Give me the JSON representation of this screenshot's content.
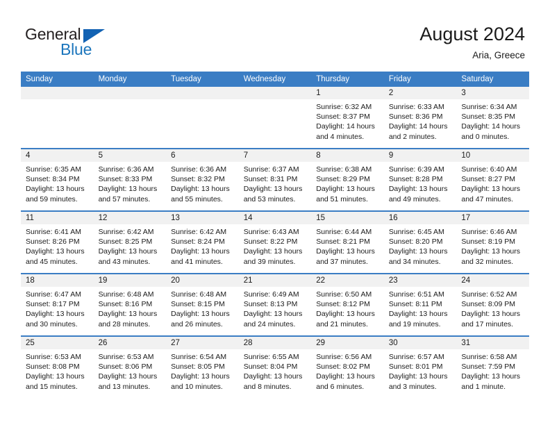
{
  "header": {
    "logo": {
      "word_one": "General",
      "word_two": "Blue",
      "triangle_color": "#1262b3",
      "blue_color": "#1b75bc"
    },
    "month_title": "August 2024",
    "location": "Aria, Greece"
  },
  "calendar": {
    "accent_color": "#3a7dc4",
    "weekday_headers": [
      "Sunday",
      "Monday",
      "Tuesday",
      "Wednesday",
      "Thursday",
      "Friday",
      "Saturday"
    ],
    "weeks": [
      [
        {
          "day": "",
          "sunrise": "",
          "sunset": "",
          "daylight": ""
        },
        {
          "day": "",
          "sunrise": "",
          "sunset": "",
          "daylight": ""
        },
        {
          "day": "",
          "sunrise": "",
          "sunset": "",
          "daylight": ""
        },
        {
          "day": "",
          "sunrise": "",
          "sunset": "",
          "daylight": ""
        },
        {
          "day": "1",
          "sunrise": "Sunrise: 6:32 AM",
          "sunset": "Sunset: 8:37 PM",
          "daylight": "Daylight: 14 hours and 4 minutes."
        },
        {
          "day": "2",
          "sunrise": "Sunrise: 6:33 AM",
          "sunset": "Sunset: 8:36 PM",
          "daylight": "Daylight: 14 hours and 2 minutes."
        },
        {
          "day": "3",
          "sunrise": "Sunrise: 6:34 AM",
          "sunset": "Sunset: 8:35 PM",
          "daylight": "Daylight: 14 hours and 0 minutes."
        }
      ],
      [
        {
          "day": "4",
          "sunrise": "Sunrise: 6:35 AM",
          "sunset": "Sunset: 8:34 PM",
          "daylight": "Daylight: 13 hours and 59 minutes."
        },
        {
          "day": "5",
          "sunrise": "Sunrise: 6:36 AM",
          "sunset": "Sunset: 8:33 PM",
          "daylight": "Daylight: 13 hours and 57 minutes."
        },
        {
          "day": "6",
          "sunrise": "Sunrise: 6:36 AM",
          "sunset": "Sunset: 8:32 PM",
          "daylight": "Daylight: 13 hours and 55 minutes."
        },
        {
          "day": "7",
          "sunrise": "Sunrise: 6:37 AM",
          "sunset": "Sunset: 8:31 PM",
          "daylight": "Daylight: 13 hours and 53 minutes."
        },
        {
          "day": "8",
          "sunrise": "Sunrise: 6:38 AM",
          "sunset": "Sunset: 8:29 PM",
          "daylight": "Daylight: 13 hours and 51 minutes."
        },
        {
          "day": "9",
          "sunrise": "Sunrise: 6:39 AM",
          "sunset": "Sunset: 8:28 PM",
          "daylight": "Daylight: 13 hours and 49 minutes."
        },
        {
          "day": "10",
          "sunrise": "Sunrise: 6:40 AM",
          "sunset": "Sunset: 8:27 PM",
          "daylight": "Daylight: 13 hours and 47 minutes."
        }
      ],
      [
        {
          "day": "11",
          "sunrise": "Sunrise: 6:41 AM",
          "sunset": "Sunset: 8:26 PM",
          "daylight": "Daylight: 13 hours and 45 minutes."
        },
        {
          "day": "12",
          "sunrise": "Sunrise: 6:42 AM",
          "sunset": "Sunset: 8:25 PM",
          "daylight": "Daylight: 13 hours and 43 minutes."
        },
        {
          "day": "13",
          "sunrise": "Sunrise: 6:42 AM",
          "sunset": "Sunset: 8:24 PM",
          "daylight": "Daylight: 13 hours and 41 minutes."
        },
        {
          "day": "14",
          "sunrise": "Sunrise: 6:43 AM",
          "sunset": "Sunset: 8:22 PM",
          "daylight": "Daylight: 13 hours and 39 minutes."
        },
        {
          "day": "15",
          "sunrise": "Sunrise: 6:44 AM",
          "sunset": "Sunset: 8:21 PM",
          "daylight": "Daylight: 13 hours and 37 minutes."
        },
        {
          "day": "16",
          "sunrise": "Sunrise: 6:45 AM",
          "sunset": "Sunset: 8:20 PM",
          "daylight": "Daylight: 13 hours and 34 minutes."
        },
        {
          "day": "17",
          "sunrise": "Sunrise: 6:46 AM",
          "sunset": "Sunset: 8:19 PM",
          "daylight": "Daylight: 13 hours and 32 minutes."
        }
      ],
      [
        {
          "day": "18",
          "sunrise": "Sunrise: 6:47 AM",
          "sunset": "Sunset: 8:17 PM",
          "daylight": "Daylight: 13 hours and 30 minutes."
        },
        {
          "day": "19",
          "sunrise": "Sunrise: 6:48 AM",
          "sunset": "Sunset: 8:16 PM",
          "daylight": "Daylight: 13 hours and 28 minutes."
        },
        {
          "day": "20",
          "sunrise": "Sunrise: 6:48 AM",
          "sunset": "Sunset: 8:15 PM",
          "daylight": "Daylight: 13 hours and 26 minutes."
        },
        {
          "day": "21",
          "sunrise": "Sunrise: 6:49 AM",
          "sunset": "Sunset: 8:13 PM",
          "daylight": "Daylight: 13 hours and 24 minutes."
        },
        {
          "day": "22",
          "sunrise": "Sunrise: 6:50 AM",
          "sunset": "Sunset: 8:12 PM",
          "daylight": "Daylight: 13 hours and 21 minutes."
        },
        {
          "day": "23",
          "sunrise": "Sunrise: 6:51 AM",
          "sunset": "Sunset: 8:11 PM",
          "daylight": "Daylight: 13 hours and 19 minutes."
        },
        {
          "day": "24",
          "sunrise": "Sunrise: 6:52 AM",
          "sunset": "Sunset: 8:09 PM",
          "daylight": "Daylight: 13 hours and 17 minutes."
        }
      ],
      [
        {
          "day": "25",
          "sunrise": "Sunrise: 6:53 AM",
          "sunset": "Sunset: 8:08 PM",
          "daylight": "Daylight: 13 hours and 15 minutes."
        },
        {
          "day": "26",
          "sunrise": "Sunrise: 6:53 AM",
          "sunset": "Sunset: 8:06 PM",
          "daylight": "Daylight: 13 hours and 13 minutes."
        },
        {
          "day": "27",
          "sunrise": "Sunrise: 6:54 AM",
          "sunset": "Sunset: 8:05 PM",
          "daylight": "Daylight: 13 hours and 10 minutes."
        },
        {
          "day": "28",
          "sunrise": "Sunrise: 6:55 AM",
          "sunset": "Sunset: 8:04 PM",
          "daylight": "Daylight: 13 hours and 8 minutes."
        },
        {
          "day": "29",
          "sunrise": "Sunrise: 6:56 AM",
          "sunset": "Sunset: 8:02 PM",
          "daylight": "Daylight: 13 hours and 6 minutes."
        },
        {
          "day": "30",
          "sunrise": "Sunrise: 6:57 AM",
          "sunset": "Sunset: 8:01 PM",
          "daylight": "Daylight: 13 hours and 3 minutes."
        },
        {
          "day": "31",
          "sunrise": "Sunrise: 6:58 AM",
          "sunset": "Sunset: 7:59 PM",
          "daylight": "Daylight: 13 hours and 1 minute."
        }
      ]
    ]
  }
}
